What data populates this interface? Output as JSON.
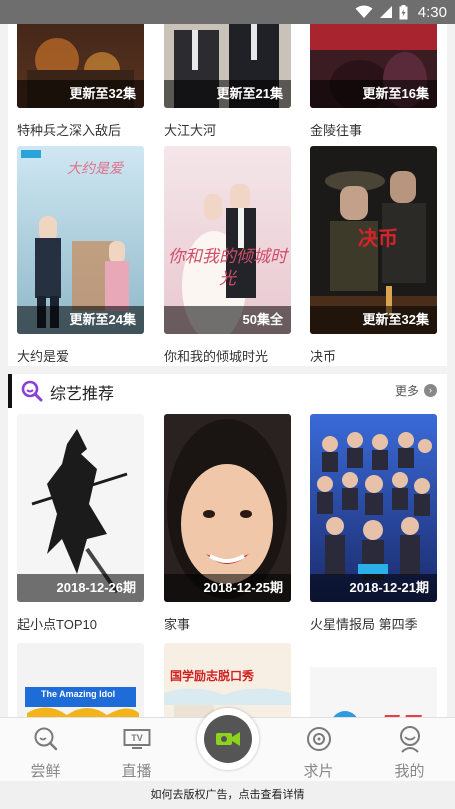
{
  "status_bar": {
    "time": "4:30"
  },
  "tv_row_top": [
    {
      "badge": "更新至32集",
      "title": "特种兵之深入敌后"
    },
    {
      "badge": "更新至21集",
      "title": "大江大河"
    },
    {
      "badge": "更新至16集",
      "title": "金陵往事"
    }
  ],
  "tv_row_second": [
    {
      "badge": "更新至24集",
      "title": "大约是爱"
    },
    {
      "badge": "50集全",
      "title": "你和我的倾城时光"
    },
    {
      "badge": "更新至32集",
      "title": "决币"
    }
  ],
  "variety": {
    "title": "综艺推荐",
    "more": "更多",
    "items": [
      {
        "badge": "2018-12-26期",
        "title": "起小点TOP10"
      },
      {
        "badge": "2018-12-25期",
        "title": "家事"
      },
      {
        "badge": "2018-12-21期",
        "title": "火星情报局 第四季"
      }
    ]
  },
  "poster_text": {
    "poster_2_1": "大约是爱",
    "poster_2_2": "你和我的倾城时光",
    "poster_2_3": "决币",
    "poster_4_1": "The Amazing Idol",
    "poster_4_2": "国学励志脱口秀"
  },
  "tabs": [
    {
      "label": "尝鲜"
    },
    {
      "label": "直播"
    },
    {
      "label": ""
    },
    {
      "label": "求片"
    },
    {
      "label": "我的"
    }
  ],
  "ad_text": "如何去版权广告，点击查看详情"
}
